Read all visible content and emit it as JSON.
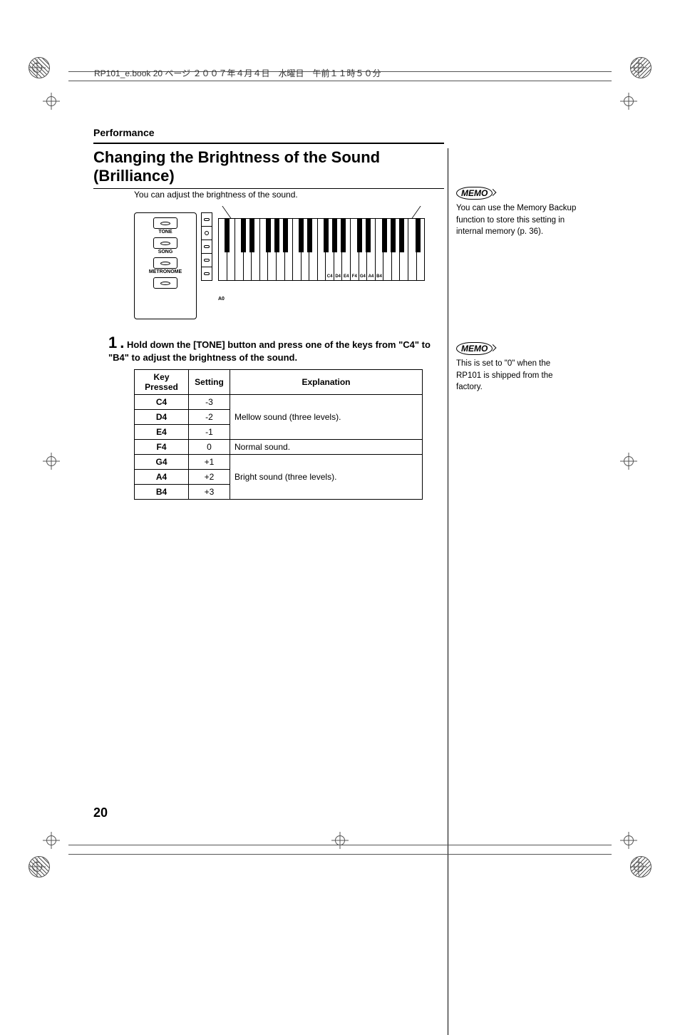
{
  "header_crumb": "RP101_e.book  20 ページ  ２００７年４月４日　水曜日　午前１１時５０分",
  "section_label": "Performance",
  "title": "Changing the Brightness of the Sound (Brilliance)",
  "intro": "You can adjust the brightness of the sound.",
  "panel": {
    "tone": "TONE",
    "song": "SONG",
    "metronome": "METRONOME"
  },
  "diagram": {
    "a0": "A0",
    "key_labels": [
      "C4",
      "D4",
      "E4",
      "F4",
      "G4",
      "A4",
      "B4"
    ]
  },
  "step": {
    "num": "1",
    "dot": ".",
    "text": "Hold down the [TONE] button and press one of the keys from \"C4\" to \"B4\" to adjust the brightness of the sound."
  },
  "table": {
    "headers": {
      "key": "Key Pressed",
      "setting": "Setting",
      "explanation": "Explanation"
    },
    "rows": [
      {
        "key": "C4",
        "setting": "-3"
      },
      {
        "key": "D4",
        "setting": "-2"
      },
      {
        "key": "E4",
        "setting": "-1"
      },
      {
        "key": "F4",
        "setting": "0"
      },
      {
        "key": "G4",
        "setting": "+1"
      },
      {
        "key": "A4",
        "setting": "+2"
      },
      {
        "key": "B4",
        "setting": "+3"
      }
    ],
    "explanations": {
      "mellow": "Mellow sound (three levels).",
      "normal": "Normal sound.",
      "bright": "Bright sound (three levels)."
    }
  },
  "memo_label": "MEMO",
  "memo1": "You can use the Memory Backup function to store this setting in internal memory (p. 36).",
  "memo2": "This is set to \"0\" when the RP101 is shipped from the factory.",
  "page_number": "20"
}
